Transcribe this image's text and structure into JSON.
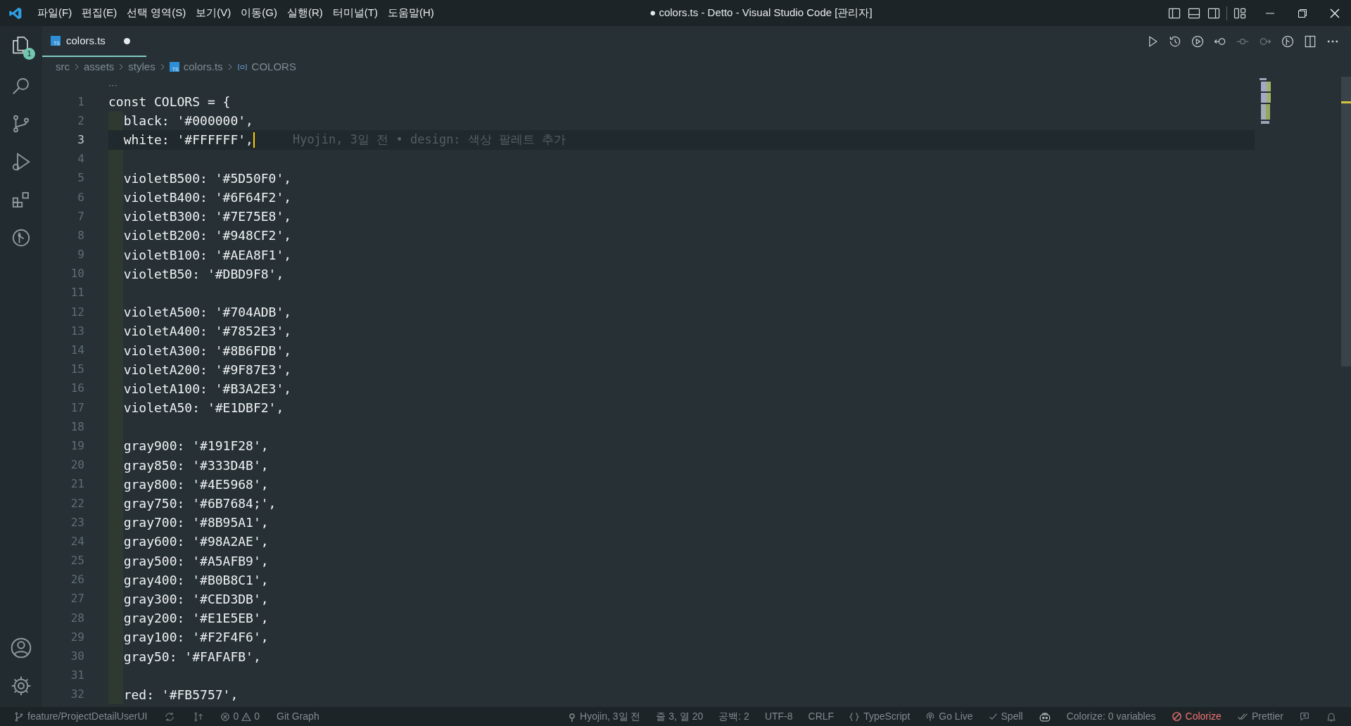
{
  "title_bar": {
    "menus": [
      "파일(F)",
      "편집(E)",
      "선택 영역(S)",
      "보기(V)",
      "이동(G)",
      "실행(R)",
      "터미널(T)",
      "도움말(H)"
    ],
    "title": "● colors.ts - Detto - Visual Studio Code [관리자]"
  },
  "activity_bar": {
    "explorer_badge": "1"
  },
  "tabs": [
    {
      "label": "colors.ts",
      "badge": "TS",
      "dirty": true,
      "selected": true
    }
  ],
  "breadcrumbs": [
    {
      "kind": "folder",
      "label": "src"
    },
    {
      "kind": "folder",
      "label": "assets"
    },
    {
      "kind": "folder",
      "label": "styles"
    },
    {
      "kind": "file",
      "badge": "TS",
      "label": "colors.ts"
    },
    {
      "kind": "symbol",
      "label": "COLORS"
    }
  ],
  "fold_marker": "···",
  "lines": [
    {
      "number": "1",
      "text": "const COLORS = {",
      "current": false
    },
    {
      "number": "2",
      "text": "  black: '#000000',",
      "current": false
    },
    {
      "number": "3",
      "text": "  white: '#FFFFFF',",
      "current": true,
      "blame": "Hyojin, 3일 전 • design: 색상 팔레트 추가"
    },
    {
      "number": "4",
      "current": false
    },
    {
      "number": "5",
      "text": "  violetB500: '#5D50F0',",
      "current": false
    },
    {
      "number": "6",
      "text": "  violetB400: '#6F64F2',",
      "current": false
    },
    {
      "number": "7",
      "text": "  violetB300: '#7E75E8',",
      "current": false
    },
    {
      "number": "8",
      "text": "  violetB200: '#948CF2',",
      "current": false
    },
    {
      "number": "9",
      "text": "  violetB100: '#AEA8F1',",
      "current": false
    },
    {
      "number": "10",
      "text": "  violetB50: '#DBD9F8',",
      "current": false
    },
    {
      "number": "11",
      "current": false
    },
    {
      "number": "12",
      "text": "  violetA500: '#704ADB',",
      "current": false
    },
    {
      "number": "13",
      "text": "  violetA400: '#7852E3',",
      "current": false
    },
    {
      "number": "14",
      "text": "  violetA300: '#8B6FDB',",
      "current": false
    },
    {
      "number": "15",
      "text": "  violetA200: '#9F87E3',",
      "current": false
    },
    {
      "number": "16",
      "text": "  violetA100: '#B3A2E3',",
      "current": false
    },
    {
      "number": "17",
      "text": "  violetA50: '#E1DBF2',",
      "current": false
    },
    {
      "number": "18",
      "current": false
    },
    {
      "number": "19",
      "text": "  gray900: '#191F28',",
      "current": false
    },
    {
      "number": "20",
      "text": "  gray850: '#333D4B',",
      "current": false
    },
    {
      "number": "21",
      "text": "  gray800: '#4E5968',",
      "current": false
    },
    {
      "number": "22",
      "text": "  gray750: '#6B7684;',",
      "current": false
    },
    {
      "number": "23",
      "text": "  gray700: '#8B95A1',",
      "current": false
    },
    {
      "number": "24",
      "text": "  gray600: '#98A2AE',",
      "current": false
    },
    {
      "number": "25",
      "text": "  gray500: '#A5AFB9',",
      "current": false
    },
    {
      "number": "26",
      "text": "  gray400: '#B0B8C1',",
      "current": false
    },
    {
      "number": "27",
      "text": "  gray300: '#CED3DB',",
      "current": false
    },
    {
      "number": "28",
      "text": "  gray200: '#E1E5EB',",
      "current": false
    },
    {
      "number": "29",
      "text": "  gray100: '#F2F4F6',",
      "current": false
    },
    {
      "number": "30",
      "text": "  gray50: '#FAFAFB',",
      "current": false
    },
    {
      "number": "31",
      "current": false
    },
    {
      "number": "32",
      "text": "  red: '#FB5757',",
      "current": false
    }
  ],
  "status_bar": {
    "left": [
      {
        "kind": "branch",
        "text": "feature/ProjectDetailUserUI"
      },
      {
        "kind": "sync"
      },
      {
        "kind": "publish"
      },
      {
        "kind": "problems",
        "errors": "0",
        "warnings": "0"
      },
      {
        "kind": "plain",
        "text": "Git Graph"
      }
    ],
    "right": [
      {
        "kind": "commit",
        "text": "Hyojin, 3일 전"
      },
      {
        "kind": "plain",
        "text": "줄 3, 열 20"
      },
      {
        "kind": "plain",
        "text": "공백: 2"
      },
      {
        "kind": "plain",
        "text": "UTF-8"
      },
      {
        "kind": "plain",
        "text": "CRLF"
      },
      {
        "kind": "language",
        "text": "TypeScript"
      },
      {
        "kind": "golive",
        "text": "Go Live"
      },
      {
        "kind": "check",
        "text": "Spell"
      },
      {
        "kind": "copilot"
      },
      {
        "kind": "plain",
        "text": "Colorize: 0 variables"
      },
      {
        "kind": "blocked",
        "text": "Colorize"
      },
      {
        "kind": "doublecheck",
        "text": "Prettier"
      },
      {
        "kind": "feedback"
      },
      {
        "kind": "bell"
      }
    ]
  }
}
